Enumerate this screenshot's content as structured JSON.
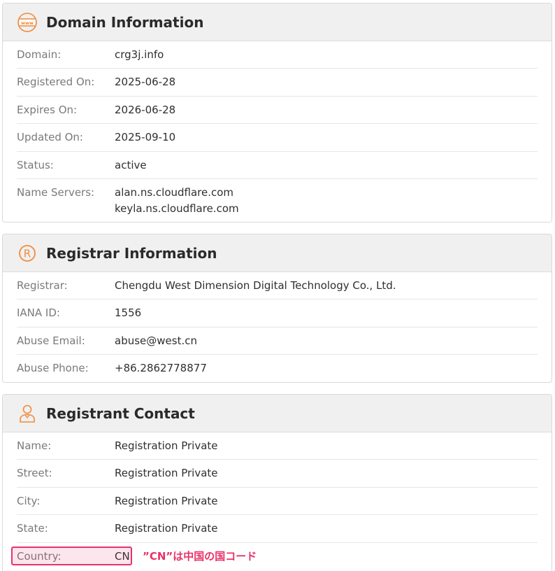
{
  "accent_color": "#f08a3c",
  "annotation_color": "#e8336a",
  "domain_card": {
    "icon": "www-globe-icon",
    "title": "Domain Information",
    "rows": [
      {
        "label": "Domain:",
        "value": "crg3j.info"
      },
      {
        "label": "Registered On:",
        "value": "2025-06-28"
      },
      {
        "label": "Expires On:",
        "value": "2026-06-28"
      },
      {
        "label": "Updated On:",
        "value": "2025-09-10"
      },
      {
        "label": "Status:",
        "value": "active"
      },
      {
        "label": "Name Servers:",
        "values": [
          "alan.ns.cloudflare.com",
          "keyla.ns.cloudflare.com"
        ]
      }
    ]
  },
  "registrar_card": {
    "icon": "registered-mark-icon",
    "title": "Registrar Information",
    "rows": [
      {
        "label": "Registrar:",
        "value": "Chengdu West Dimension Digital Technology Co., Ltd."
      },
      {
        "label": "IANA ID:",
        "value": "1556"
      },
      {
        "label": "Abuse Email:",
        "value": "abuse@west.cn"
      },
      {
        "label": "Abuse Phone:",
        "value": "+86.2862778877"
      }
    ]
  },
  "registrant_card": {
    "icon": "person-icon",
    "title": "Registrant Contact",
    "rows": [
      {
        "label": "Name:",
        "value": "Registration Private"
      },
      {
        "label": "Street:",
        "value": "Registration Private"
      },
      {
        "label": "City:",
        "value": "Registration Private"
      },
      {
        "label": "State:",
        "value": "Registration Private"
      },
      {
        "label": "Country:",
        "value": "CN"
      }
    ]
  },
  "annotation": {
    "text": "”CN”は中国の国コード"
  }
}
